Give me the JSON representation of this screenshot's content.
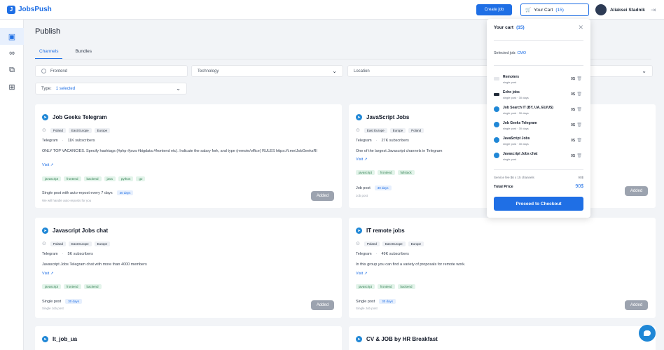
{
  "header": {
    "logo_letter": "J",
    "logo_text": "JobsPush",
    "create_job": "Create job",
    "cart_label": "Your Cart",
    "cart_count": "(15)",
    "user_name": "Aliaksei Stadnik"
  },
  "sidebar": {
    "items": [
      {
        "icon": "briefcase-icon",
        "glyph": "▣"
      },
      {
        "icon": "binoculars-icon",
        "glyph": "∞"
      },
      {
        "icon": "copy-icon",
        "glyph": "⧉"
      },
      {
        "icon": "gift-icon",
        "glyph": "⊞"
      }
    ]
  },
  "main": {
    "title": "Publish",
    "tabs": [
      "Channels",
      "Bundles"
    ],
    "filters": {
      "frontend": "Frontend",
      "technology": "Technology",
      "location": "Location",
      "type_label": "Type:",
      "type_value": "1 selected"
    }
  },
  "cards": [
    {
      "title": "Job Geeks Telegram",
      "locations": [
        "Poland",
        "East Europe",
        "Europe"
      ],
      "platform": "Telegram",
      "subscribers": "11K subscribers",
      "description": "ONLY TOP VACANCIES. Specify hashtags (#php #java #bigdata #frontend etc). Indicate the salary fork, and type (remote/office) RULES https://t.me/JobGeeksRl",
      "visit": "Visit ↗",
      "tags": [
        "javascript",
        "frontend",
        "backend",
        "java",
        "python",
        "go"
      ],
      "post_text": "Single post with auto-repost every 7 days",
      "post_pill": "30 days",
      "note": "We will handle auto-reposts for you",
      "button": "Added"
    },
    {
      "title": "JavaScript Jobs",
      "locations": [
        "East Europe",
        "Europe",
        "Poland"
      ],
      "platform": "Telegram",
      "subscribers": "27K subscribers",
      "description": "One of the largest Javascript channels in Telegram",
      "visit": "Visit ↗",
      "tags": [
        "javascript",
        "frontend",
        "fullstack"
      ],
      "post_text": "Job post",
      "post_pill": "30 days",
      "note": "Job post",
      "button": "Added"
    },
    {
      "title": "Javascript Jobs chat",
      "locations": [
        "Poland",
        "East Europe",
        "Europe"
      ],
      "platform": "Telegram",
      "subscribers": "5K subscribers",
      "description": "Javascript Jobs Telegram chat with more than 4000 members",
      "visit": "Visit ↗",
      "tags": [
        "javascript",
        "frontend",
        "backend"
      ],
      "post_text": "Single post",
      "post_pill": "30 days",
      "note": "Single Job post",
      "button": "Added"
    },
    {
      "title": "IT remote jobs",
      "locations": [
        "Poland",
        "East Europe",
        "Europe"
      ],
      "platform": "Telegram",
      "subscribers": "49K subscribers",
      "description": "In this group you can find a variety of proposals for remote work.",
      "visit": "Visit ↗",
      "tags": [
        "javascript",
        "frontend",
        "backend"
      ],
      "post_text": "Single post",
      "post_pill": "30 days",
      "note": "Single Job post",
      "button": "Added"
    },
    {
      "title": "It_job_ua"
    },
    {
      "title": "CV & JOB by HR Breakfast"
    }
  ],
  "cart": {
    "title": "Your cart",
    "count": "(15)",
    "selected_label": "Selected job:",
    "selected_value": "CMO",
    "items": [
      {
        "name": "Remoters",
        "sub": "single post",
        "price": "0$",
        "icon": "sq"
      },
      {
        "name": "Echo jobs",
        "sub": "single post  ·  30 days",
        "price": "0$",
        "icon": "dk"
      },
      {
        "name": "Job Search IT (BY, UA, EU/US)",
        "sub": "single post  ·  30 days",
        "price": "0$",
        "icon": "tg"
      },
      {
        "name": "Job Geeks Telegram",
        "sub": "single post  ·  30 days",
        "price": "0$",
        "icon": "tg"
      },
      {
        "name": "JavaScript Jobs",
        "sub": "single post  ·  30 days",
        "price": "0$",
        "icon": "tg"
      },
      {
        "name": "Javascript Jobs chat",
        "sub": "single post",
        "price": "0$",
        "icon": "tg"
      }
    ],
    "fee_label": "Service fee $6 x 15 channels",
    "fee_value": "90$",
    "total_label": "Total Price",
    "total_value": "90$",
    "checkout": "Proceed to Checkout"
  }
}
